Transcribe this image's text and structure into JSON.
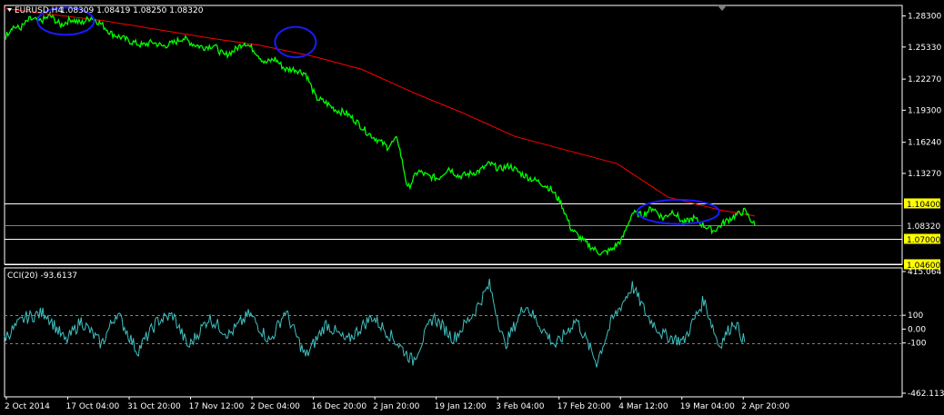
{
  "header": {
    "symbol_label": "EURUSD,H4",
    "ohlc": "1.08309 1.08419 1.08250 1.08320",
    "cci_label": "CCI(20) -93.6137"
  },
  "colors": {
    "background": "#000000",
    "price_line": "#00ff00",
    "moving_average": "#ff0000",
    "cci_line": "#40c0c0",
    "annotation": "#1a1aff",
    "level_tag": "#ffff00",
    "grid": "#808080",
    "axis_text": "#ffffff"
  },
  "chart_data": [
    {
      "type": "line",
      "title": "EURUSD,H4",
      "y_axis_ticks": [
        "1.28300",
        "1.25330",
        "1.22270",
        "1.19300",
        "1.16240",
        "1.13270"
      ],
      "ylim": [
        1.046,
        1.293
      ],
      "horizontal_levels": [
        {
          "value": 1.104,
          "label": "1.10400",
          "highlight": true
        },
        {
          "value": 1.0832,
          "label": "1.08320",
          "highlight": false
        },
        {
          "value": 1.07,
          "label": "1.07000",
          "highlight": true
        },
        {
          "value": 1.046,
          "label": "1.04600",
          "highlight": true
        }
      ],
      "x_tick_labels": [
        "2 Oct 2014",
        "17 Oct 04:00",
        "31 Oct 20:00",
        "17 Nov 12:00",
        "2 Dec 04:00",
        "16 Dec 20:00",
        "2 Jan 20:00",
        "19 Jan 12:00",
        "3 Feb 04:00",
        "17 Feb 20:00",
        "4 Mar 12:00",
        "19 Mar 04:00",
        "2 Apr 20:00"
      ],
      "series": [
        {
          "role": "price",
          "anchors": [
            [
              0,
              1.262
            ],
            [
              3,
              1.273
            ],
            [
              6,
              1.271
            ],
            [
              10,
              1.28
            ],
            [
              14,
              1.278
            ],
            [
              18,
              1.283
            ],
            [
              22,
              1.274
            ],
            [
              26,
              1.28
            ],
            [
              30,
              1.276
            ],
            [
              34,
              1.282
            ],
            [
              38,
              1.275
            ],
            [
              42,
              1.266
            ],
            [
              46,
              1.262
            ],
            [
              50,
              1.258
            ],
            [
              54,
              1.255
            ],
            [
              58,
              1.258
            ],
            [
              62,
              1.254
            ],
            [
              66,
              1.257
            ],
            [
              70,
              1.262
            ],
            [
              74,
              1.256
            ],
            [
              78,
              1.253
            ],
            [
              82,
              1.255
            ],
            [
              86,
              1.245
            ],
            [
              90,
              1.25
            ],
            [
              94,
              1.258
            ],
            [
              98,
              1.25
            ],
            [
              102,
              1.238
            ],
            [
              106,
              1.242
            ],
            [
              110,
              1.232
            ],
            [
              114,
              1.232
            ],
            [
              118,
              1.228
            ],
            [
              122,
              1.205
            ],
            [
              126,
              1.2
            ],
            [
              130,
              1.193
            ],
            [
              134,
              1.19
            ],
            [
              138,
              1.182
            ],
            [
              142,
              1.172
            ],
            [
              146,
              1.165
            ],
            [
              150,
              1.158
            ],
            [
              154,
              1.166
            ],
            [
              158,
              1.118
            ],
            [
              162,
              1.135
            ],
            [
              166,
              1.13
            ],
            [
              170,
              1.128
            ],
            [
              174,
              1.138
            ],
            [
              178,
              1.13
            ],
            [
              182,
              1.132
            ],
            [
              186,
              1.135
            ],
            [
              190,
              1.142
            ],
            [
              194,
              1.137
            ],
            [
              198,
              1.14
            ],
            [
              202,
              1.133
            ],
            [
              206,
              1.128
            ],
            [
              210,
              1.124
            ],
            [
              214,
              1.118
            ],
            [
              218,
              1.105
            ],
            [
              222,
              1.08
            ],
            [
              226,
              1.07
            ],
            [
              230,
              1.062
            ],
            [
              234,
              1.056
            ],
            [
              238,
              1.06
            ],
            [
              242,
              1.07
            ],
            [
              246,
              1.095
            ],
            [
              250,
              1.093
            ],
            [
              254,
              1.1
            ],
            [
              258,
              1.09
            ],
            [
              262,
              1.097
            ],
            [
              266,
              1.085
            ],
            [
              270,
              1.09
            ],
            [
              274,
              1.083
            ],
            [
              278,
              1.078
            ],
            [
              282,
              1.086
            ],
            [
              286,
              1.092
            ],
            [
              290,
              1.097
            ],
            [
              294,
              1.0832
            ]
          ]
        },
        {
          "role": "moving-average",
          "anchors": [
            [
              0,
              1.29
            ],
            [
              20,
              1.284
            ],
            [
              40,
              1.278
            ],
            [
              60,
              1.27
            ],
            [
              80,
              1.262
            ],
            [
              100,
              1.255
            ],
            [
              120,
              1.245
            ],
            [
              140,
              1.232
            ],
            [
              160,
              1.21
            ],
            [
              180,
              1.19
            ],
            [
              200,
              1.168
            ],
            [
              220,
              1.155
            ],
            [
              240,
              1.142
            ],
            [
              260,
              1.11
            ],
            [
              280,
              1.098
            ],
            [
              294,
              1.092
            ]
          ]
        }
      ],
      "x_domain": [
        0,
        300
      ],
      "annotations": [
        {
          "shape": "ellipse",
          "cx": 24,
          "cy": 1.278,
          "rx": 11,
          "ry": 0.013
        },
        {
          "shape": "ellipse",
          "cx": 114,
          "cy": 1.258,
          "rx": 8,
          "ry": 0.0145
        },
        {
          "shape": "ellipse",
          "cx": 264,
          "cy": 1.096,
          "rx": 16,
          "ry": 0.0115
        }
      ]
    },
    {
      "type": "line",
      "title": "CCI(20) -93.6137",
      "y_axis_ticks": [
        "415.064",
        "100",
        "0.00",
        "-100",
        "-462.1133"
      ],
      "ylim": [
        -462.1133,
        415.064
      ],
      "reference_levels": [
        100,
        -100
      ],
      "series": [
        {
          "role": "cci",
          "anchors": [
            [
              0,
              -60
            ],
            [
              8,
              80
            ],
            [
              16,
              120
            ],
            [
              24,
              -90
            ],
            [
              30,
              60
            ],
            [
              38,
              -110
            ],
            [
              44,
              120
            ],
            [
              52,
              -160
            ],
            [
              60,
              60
            ],
            [
              66,
              100
            ],
            [
              72,
              -130
            ],
            [
              80,
              80
            ],
            [
              88,
              -40
            ],
            [
              96,
              110
            ],
            [
              104,
              -90
            ],
            [
              110,
              130
            ],
            [
              118,
              -200
            ],
            [
              126,
              40
            ],
            [
              134,
              -90
            ],
            [
              144,
              90
            ],
            [
              152,
              -60
            ],
            [
              160,
              -230
            ],
            [
              168,
              90
            ],
            [
              176,
              -70
            ],
            [
              184,
              120
            ],
            [
              190,
              320
            ],
            [
              196,
              -120
            ],
            [
              204,
              180
            ],
            [
              210,
              20
            ],
            [
              216,
              -120
            ],
            [
              224,
              70
            ],
            [
              232,
              -240
            ],
            [
              238,
              60
            ],
            [
              246,
              310
            ],
            [
              252,
              90
            ],
            [
              258,
              -40
            ],
            [
              266,
              -90
            ],
            [
              274,
              210
            ],
            [
              280,
              -120
            ],
            [
              286,
              60
            ],
            [
              290,
              -93.6137
            ]
          ]
        }
      ],
      "x_domain": [
        0,
        300
      ]
    }
  ]
}
